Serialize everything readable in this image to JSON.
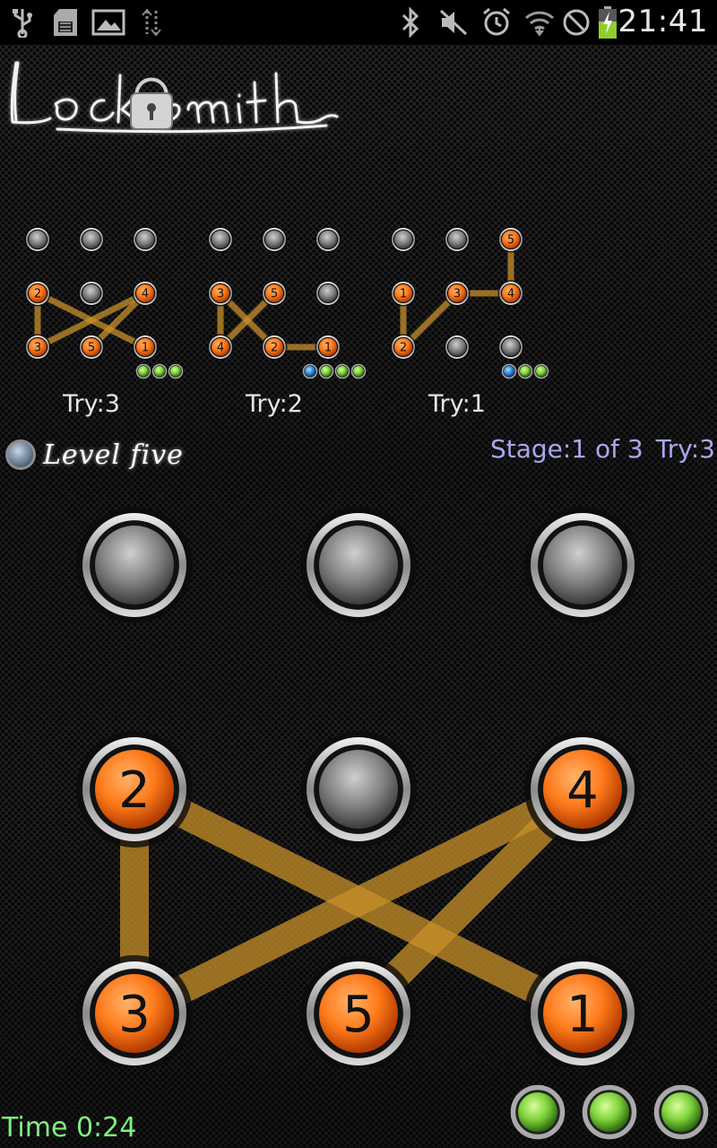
{
  "status_bar": {
    "time": "21:41",
    "left_icons": [
      "usb-icon",
      "sd-card-icon",
      "image-icon",
      "sync-icon"
    ],
    "right_icons": [
      "bluetooth-icon",
      "mute-icon",
      "alarm-icon",
      "wifi-icon",
      "blocked-icon",
      "battery-charging-icon"
    ]
  },
  "app": {
    "logo_text": "Locksmith",
    "level_label": "Level five",
    "stage_label": "Stage:1 of 3",
    "try_label": "Try:3",
    "time_label": "Time 0:24"
  },
  "history": [
    {
      "label": "Try:3",
      "nodes": [
        {
          "row": 0,
          "col": 0,
          "n": ""
        },
        {
          "row": 0,
          "col": 1,
          "n": ""
        },
        {
          "row": 0,
          "col": 2,
          "n": ""
        },
        {
          "row": 1,
          "col": 0,
          "n": "2"
        },
        {
          "row": 1,
          "col": 1,
          "n": ""
        },
        {
          "row": 1,
          "col": 2,
          "n": "4"
        },
        {
          "row": 2,
          "col": 0,
          "n": "3"
        },
        {
          "row": 2,
          "col": 1,
          "n": "5"
        },
        {
          "row": 2,
          "col": 2,
          "n": "1"
        }
      ],
      "path": [
        "2",
        "3",
        "4",
        "5",
        "1"
      ],
      "lines": [
        [
          "2",
          "3"
        ],
        [
          "2",
          "1"
        ],
        [
          "3",
          "4"
        ],
        [
          "4",
          "5"
        ]
      ],
      "result_dots": [
        "green",
        "green",
        "green"
      ]
    },
    {
      "label": "Try:2",
      "nodes": [
        {
          "row": 0,
          "col": 0,
          "n": ""
        },
        {
          "row": 0,
          "col": 1,
          "n": ""
        },
        {
          "row": 0,
          "col": 2,
          "n": ""
        },
        {
          "row": 1,
          "col": 0,
          "n": "3"
        },
        {
          "row": 1,
          "col": 1,
          "n": "5"
        },
        {
          "row": 1,
          "col": 2,
          "n": ""
        },
        {
          "row": 2,
          "col": 0,
          "n": "4"
        },
        {
          "row": 2,
          "col": 1,
          "n": "2"
        },
        {
          "row": 2,
          "col": 2,
          "n": "1"
        }
      ],
      "lines": [
        [
          "3",
          "4"
        ],
        [
          "3",
          "2"
        ],
        [
          "4",
          "5"
        ],
        [
          "2",
          "1"
        ]
      ],
      "result_dots": [
        "blue",
        "green",
        "green",
        "green"
      ]
    },
    {
      "label": "Try:1",
      "nodes": [
        {
          "row": 0,
          "col": 0,
          "n": ""
        },
        {
          "row": 0,
          "col": 1,
          "n": ""
        },
        {
          "row": 0,
          "col": 2,
          "n": "5"
        },
        {
          "row": 1,
          "col": 0,
          "n": "1"
        },
        {
          "row": 1,
          "col": 1,
          "n": "3"
        },
        {
          "row": 1,
          "col": 2,
          "n": "4"
        },
        {
          "row": 2,
          "col": 0,
          "n": "2"
        },
        {
          "row": 2,
          "col": 1,
          "n": ""
        },
        {
          "row": 2,
          "col": 2,
          "n": ""
        }
      ],
      "lines": [
        [
          "1",
          "2"
        ],
        [
          "2",
          "3"
        ],
        [
          "3",
          "4"
        ],
        [
          "4",
          "5"
        ]
      ],
      "result_dots": [
        "blue",
        "green",
        "green"
      ]
    }
  ],
  "board": {
    "nodes": [
      {
        "row": 0,
        "col": 0,
        "n": ""
      },
      {
        "row": 0,
        "col": 1,
        "n": ""
      },
      {
        "row": 0,
        "col": 2,
        "n": ""
      },
      {
        "row": 1,
        "col": 0,
        "n": "2"
      },
      {
        "row": 1,
        "col": 1,
        "n": ""
      },
      {
        "row": 1,
        "col": 2,
        "n": "4"
      },
      {
        "row": 2,
        "col": 0,
        "n": "3"
      },
      {
        "row": 2,
        "col": 1,
        "n": "5"
      },
      {
        "row": 2,
        "col": 2,
        "n": "1"
      }
    ],
    "lines": [
      [
        "2",
        "3"
      ],
      [
        "2",
        "1"
      ],
      [
        "3",
        "4"
      ],
      [
        "4",
        "5"
      ]
    ]
  },
  "tries_remaining": [
    "green",
    "green",
    "green"
  ],
  "colors": {
    "active_orange": "#ff7a1a",
    "line_amber": "#c8902a",
    "stage_text": "#a9a8ee",
    "time_text": "#7ff07f",
    "dot_green": "#7dd13a",
    "dot_blue": "#2f8fe0"
  }
}
